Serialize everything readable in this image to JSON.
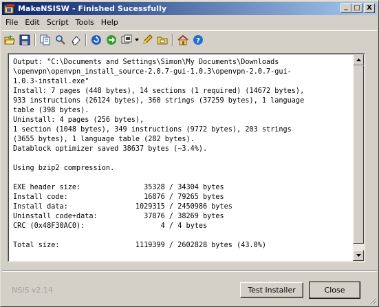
{
  "window": {
    "title": "MakeNSISW - Finished Sucessfully",
    "controls": {
      "minimize": "_",
      "maximize": "□",
      "close": "X"
    }
  },
  "menu": [
    "File",
    "Edit",
    "Script",
    "Tools",
    "Help"
  ],
  "toolbar_icons": [
    "open-script-icon",
    "save-icon",
    "copy-icon",
    "find-icon",
    "clear-log-icon",
    "recompile-icon",
    "test-installer-icon",
    "compressor-icon",
    "compressor-dropdown-icon",
    "edit-script-icon",
    "browse-script-icon",
    "nsis-home-icon",
    "help-icon"
  ],
  "log": {
    "lines": [
      "Output: \"C:\\Documents and Settings\\Simon\\My Documents\\Downloads",
      "\\openvpn\\openvpn_install_source-2.0.7-gui-1.0.3\\openvpn-2.0.7-gui-",
      "1.0.3-install.exe\"",
      "Install: 7 pages (448 bytes), 14 sections (1 required) (14672 bytes),",
      "933 instructions (26124 bytes), 360 strings (37259 bytes), 1 language",
      "table (398 bytes).",
      "Uninstall: 4 pages (256 bytes),",
      "1 section (1048 bytes), 349 instructions (9772 bytes), 203 strings",
      "(3655 bytes), 1 language table (282 bytes).",
      "Datablock optimizer saved 38637 bytes (~3.4%).",
      "",
      "Using bzip2 compression.",
      "",
      "EXE header size:               35328 / 34304 bytes",
      "Install code:                  16876 / 79265 bytes",
      "Install data:                1029315 / 2450986 bytes",
      "Uninstall code+data:           37876 / 38269 bytes",
      "CRC (0x48F30AC0):                  4 / 4 bytes",
      "",
      "Total size:                  1119399 / 2602828 bytes (43.0%)"
    ]
  },
  "footer": {
    "version": "NSIS v2.14",
    "test_button": "Test Installer",
    "close_button": "Close"
  },
  "colors": {
    "title_start": "#0a246a",
    "title_end": "#a6caf0",
    "face": "#d4d0c8",
    "log_bg": "#ffffff"
  }
}
